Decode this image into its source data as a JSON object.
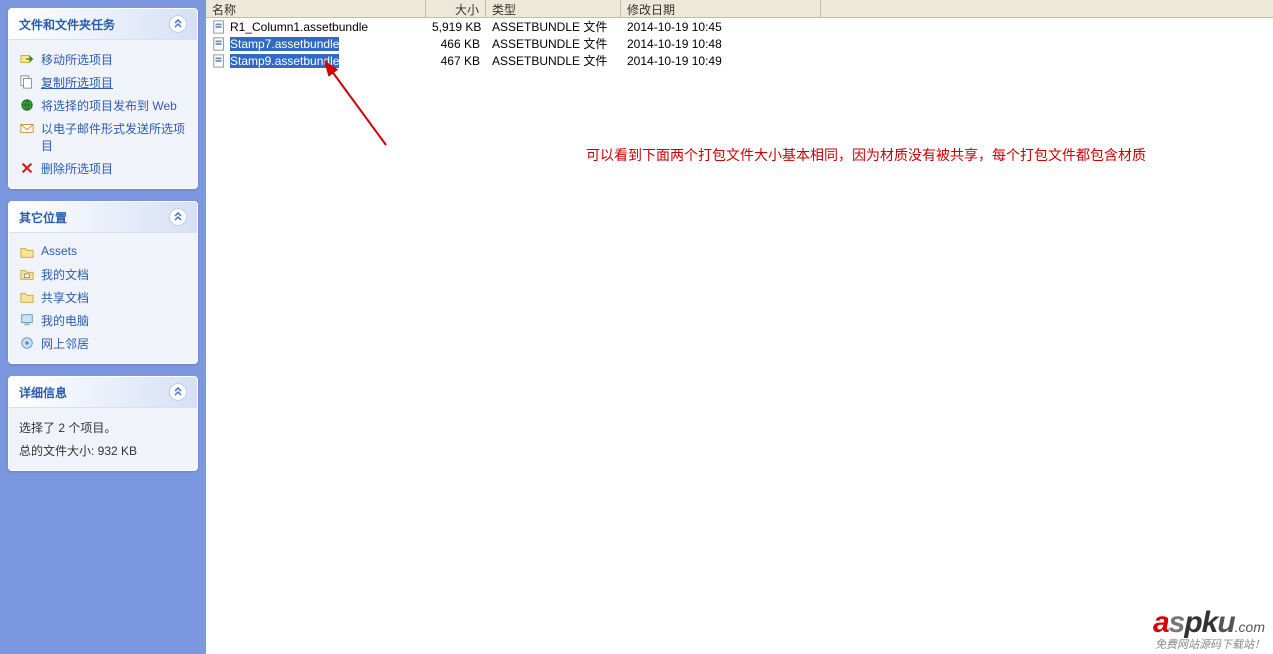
{
  "columns": {
    "name": "名称",
    "size": "大小",
    "type": "类型",
    "date": "修改日期"
  },
  "files": [
    {
      "name": "R1_Column1.assetbundle",
      "size": "5,919 KB",
      "type": "ASSETBUNDLE 文件",
      "date": "2014-10-19 10:45",
      "selected": false
    },
    {
      "name": "Stamp7.assetbundle",
      "size": "466 KB",
      "type": "ASSETBUNDLE 文件",
      "date": "2014-10-19 10:48",
      "selected": true
    },
    {
      "name": "Stamp9.assetbundle",
      "size": "467 KB",
      "type": "ASSETBUNDLE 文件",
      "date": "2014-10-19 10:49",
      "selected": true
    }
  ],
  "panels": {
    "tasks": {
      "title": "文件和文件夹任务",
      "items": [
        {
          "icon": "move",
          "label": "移动所选项目"
        },
        {
          "icon": "copy",
          "label": "复制所选项目",
          "underline": true
        },
        {
          "icon": "web",
          "label": "将选择的项目发布到 Web"
        },
        {
          "icon": "mail",
          "label": "以电子邮件形式发送所选项目"
        },
        {
          "icon": "delete",
          "label": "删除所选项目"
        }
      ]
    },
    "places": {
      "title": "其它位置",
      "items": [
        {
          "icon": "folder",
          "label": "Assets"
        },
        {
          "icon": "mydocs",
          "label": "我的文档"
        },
        {
          "icon": "shared",
          "label": "共享文档"
        },
        {
          "icon": "computer",
          "label": "我的电脑"
        },
        {
          "icon": "network",
          "label": "网上邻居"
        }
      ]
    },
    "details": {
      "title": "详细信息",
      "lines": [
        "选择了 2 个项目。",
        "总的文件大小: 932 KB"
      ]
    }
  },
  "annotation": "可以看到下面两个打包文件大小基本相同，因为材质没有被共享，每个打包文件都包含材质",
  "watermark": {
    "main": "aspku",
    "tld": ".com",
    "sub": "免费网站源码下载站！"
  }
}
